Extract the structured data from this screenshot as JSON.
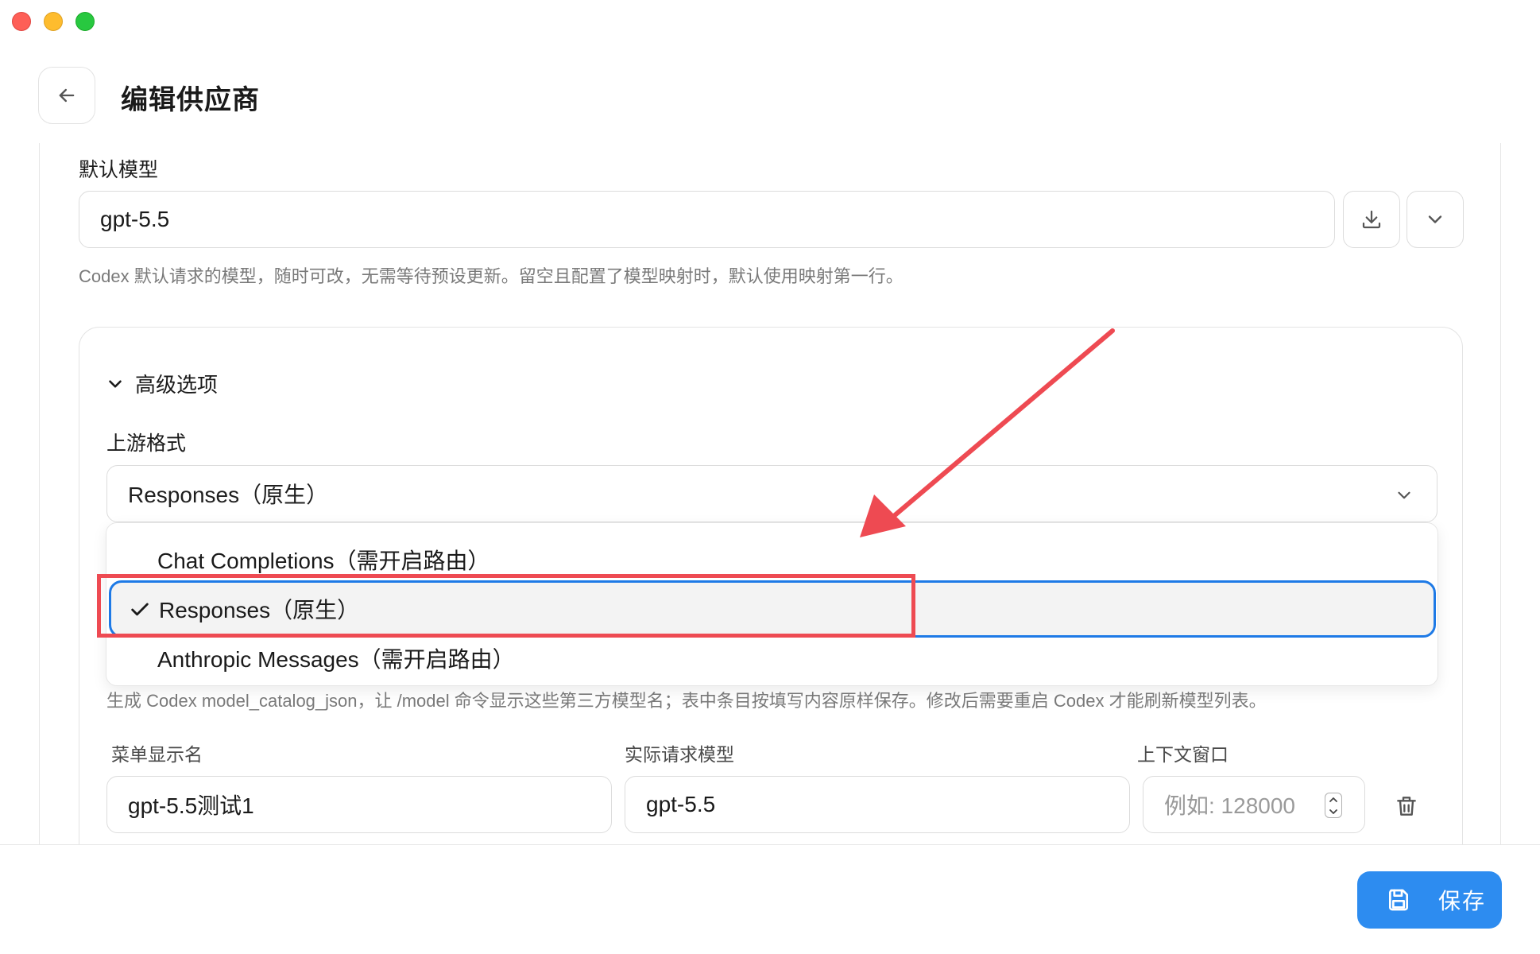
{
  "window": {
    "title": "编辑供应商"
  },
  "default_model": {
    "label": "默认模型",
    "value": "gpt-5.5",
    "hint": "Codex 默认请求的模型，随时可改，无需等待预设更新。留空且配置了模型映射时，默认使用映射第一行。"
  },
  "advanced": {
    "title": "高级选项",
    "upstream_format": {
      "label": "上游格式",
      "selected": "Responses（原生）",
      "options": [
        {
          "label": "Chat Completions（需开启路由）",
          "checked": false
        },
        {
          "label": "Responses（原生）",
          "checked": true
        },
        {
          "label": "Anthropic Messages（需开启路由）",
          "checked": false
        }
      ]
    },
    "catalog_hint": "生成 Codex model_catalog_json，让 /model 命令显示这些第三方模型名；表中条目按填写内容原样保存。修改后需要重启 Codex 才能刷新模型列表。",
    "columns": {
      "display_name": "菜单显示名",
      "request_model": "实际请求模型",
      "context_window": "上下文窗口"
    },
    "row": {
      "display_name": "gpt-5.5测试1",
      "request_model": "gpt-5.5",
      "context_window_placeholder": "例如: 128000"
    }
  },
  "footer": {
    "save_label": "保存"
  },
  "colors": {
    "accent": "#2d8cf0",
    "focus_ring": "#1e7ae6",
    "annotation": "#ee4a52"
  },
  "icons": {
    "back": "arrow-left-icon",
    "fetch_models": "download-icon",
    "model_dropdown": "chevron-down-icon",
    "advanced_toggle": "chevron-down-icon",
    "selected_option": "check-icon",
    "delete_row": "trash-icon",
    "save": "floppy-disk-icon"
  }
}
